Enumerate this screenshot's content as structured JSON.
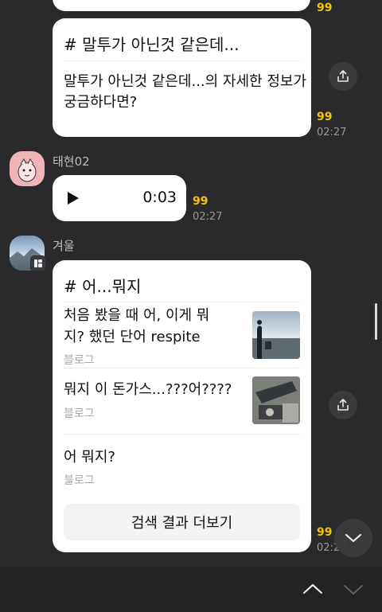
{
  "chat": {
    "card1": {
      "title": "# 말투가 아닌것 같은데...",
      "desc_line1": "말투가 아닌것 같은데...의 자세한 정보가",
      "desc_line2": "궁금하다면?",
      "unread_top": "99",
      "unread": "99",
      "time": "02:27"
    },
    "voice": {
      "sender": "태현02",
      "duration": "0:03",
      "unread": "99",
      "time": "02:27"
    },
    "card2": {
      "sender": "겨울",
      "title": "# 어...뭐지",
      "results": [
        {
          "line1": "처음 봤을 때 어, 이게 뭐",
          "line2": "지? 했던 단어 respite",
          "source": "블로그"
        },
        {
          "line1": "뭐지 이 돈가스...???어????",
          "source": "블로그"
        },
        {
          "line1": "어 뭐지?",
          "source": "블로그"
        }
      ],
      "more_button": "검색 결과 더보기",
      "unread": "99",
      "time": "02:27"
    }
  },
  "icons": {
    "share": "share-icon",
    "play": "play-icon",
    "scroll_down": "chevron-down-icon",
    "prev": "chevron-up-icon",
    "next": "chevron-down-icon"
  },
  "colors": {
    "background": "#2a2a2c",
    "bubble": "#ffffff",
    "unread": "#f4c400"
  }
}
